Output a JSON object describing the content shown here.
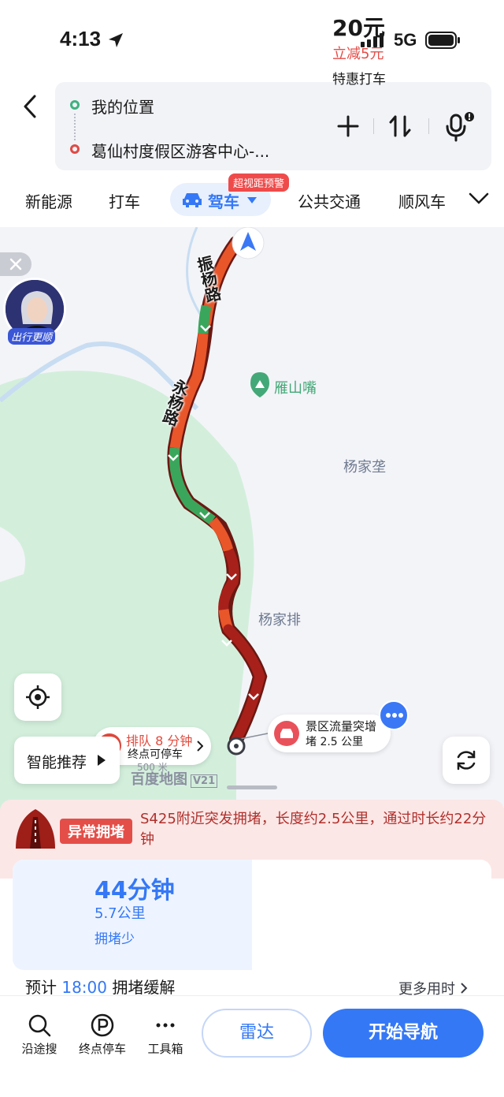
{
  "status_bar": {
    "time": "4:13",
    "network": "5G"
  },
  "route": {
    "from": "我的位置",
    "to": "葛仙村度假区游客中心-..."
  },
  "tabs": [
    {
      "label": "新能源"
    },
    {
      "label": "打车"
    },
    {
      "label": "驾车",
      "active": true
    },
    {
      "label": "公共交通"
    },
    {
      "label": "顺风车"
    }
  ],
  "tab_badge": "超视距预警",
  "map": {
    "road_labels": [
      "振杨路",
      "永杨路"
    ],
    "poi": "雁山嘴",
    "places": [
      "杨家垄",
      "杨家排"
    ],
    "avatar_caption": "出行更顺",
    "queue": {
      "line1": "排队 8 分钟",
      "line2": "终点可停车"
    },
    "jam": {
      "line1": "景区流量突增",
      "line2": "堵 2.5 公里"
    },
    "smart_recommend": "智能推荐",
    "scale": "500 米",
    "brand": "百度地图",
    "brand_version": "V21"
  },
  "alert": {
    "tag": "异常拥堵",
    "text": "S425附近突发拥堵，长度约2.5公里，通过时长约22分钟"
  },
  "options": {
    "drive": {
      "time": "44分钟",
      "distance": "5.7公里",
      "tag": "拥堵少"
    },
    "taxi": {
      "price": "20元",
      "discount": "立减5元",
      "label": "特惠打车"
    }
  },
  "forecast": {
    "prefix": "预计",
    "time": "18:00",
    "suffix": "拥堵缓解",
    "more": "更多用时"
  },
  "bottom": {
    "tools": [
      {
        "label": "沿途搜",
        "icon": "search-icon"
      },
      {
        "label": "终点停车",
        "icon": "parking-icon"
      },
      {
        "label": "工具箱",
        "icon": "more-icon"
      }
    ],
    "radar": "雷达",
    "start_nav": "开始导航"
  },
  "colors": {
    "accent": "#3478f6",
    "jam_red": "#a8201a",
    "slow_orange": "#e8562a",
    "smooth_green": "#3aa65c",
    "alert_bg": "#fbe7e6"
  }
}
